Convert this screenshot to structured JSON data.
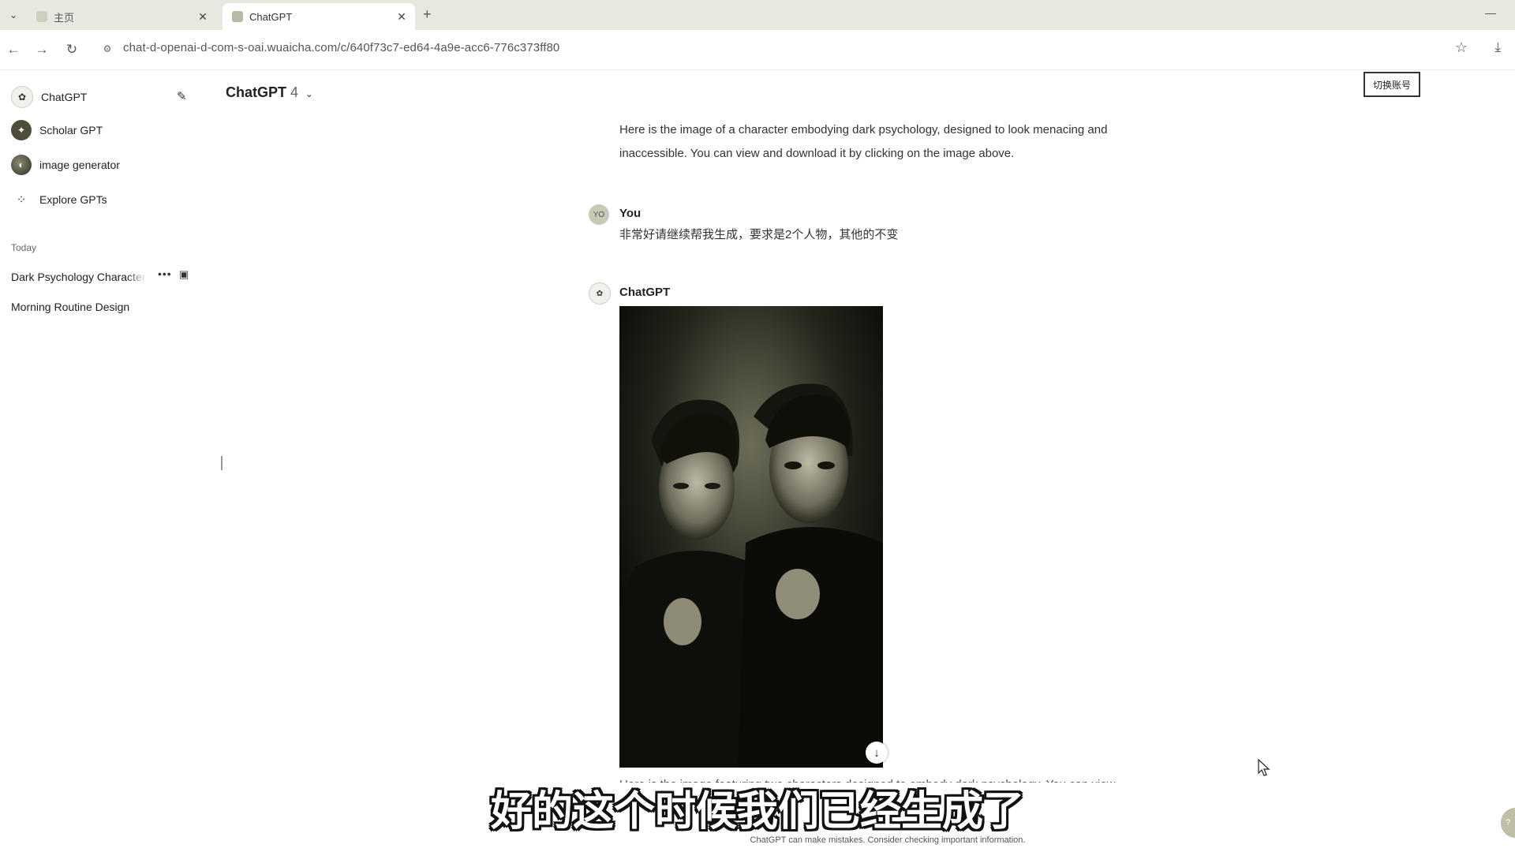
{
  "browser": {
    "tabs": [
      {
        "label": "主页",
        "active": false
      },
      {
        "label": "ChatGPT",
        "active": true
      }
    ],
    "new_tab": "+",
    "close_glyph": "✕",
    "url": "chat-d-openai-d-com-s-oai.wuaicha.com/c/640f73c7-ed64-4a9e-acc6-776c373ff80"
  },
  "sidebar": {
    "items": [
      {
        "label": "ChatGPT",
        "icon": "chatgpt-logo-icon"
      },
      {
        "label": "Scholar GPT",
        "icon": "scholar-gpt-icon"
      },
      {
        "label": "image generator",
        "icon": "image-generator-icon"
      },
      {
        "label": "Explore GPTs",
        "icon": "grid-icon"
      }
    ],
    "section_label": "Today",
    "history": [
      {
        "label": "Dark Psychology Character"
      },
      {
        "label": "Morning Routine Design"
      }
    ]
  },
  "header": {
    "model": "ChatGPT",
    "version": "4",
    "switch_account": "切换账号"
  },
  "conversation": {
    "assistant_intro": "Here is the image of a character embodying dark psychology, designed to look menacing and inaccessible. You can view and download it by clicking on the image above.",
    "user_name": "You",
    "user_avatar": "YO",
    "user_message": "非常好请继续帮我生成，要求是2个人物，其他的不变",
    "assistant_name": "ChatGPT",
    "assistant_partial": "Here is the image featuring two characters designed to embody dark psychology. You can view"
  },
  "subtitle": "好的这个时候我们已经生成了",
  "footer": "ChatGPT can make mistakes. Consider checking important information.",
  "colors": {
    "tabbar": "#e8e8e0",
    "image_bg": "#0d0f0a",
    "avatar_you": "#c9c9b8"
  }
}
